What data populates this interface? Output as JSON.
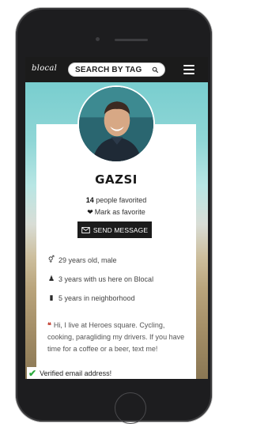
{
  "header": {
    "logo": "blocal",
    "search_placeholder": "SEARCH BY TAG"
  },
  "profile": {
    "name": "GAZSI",
    "favorited_count": "14",
    "favorited_text": " people favorited",
    "mark_favorite": "Mark as favorite",
    "send_message": "SEND MESSAGE"
  },
  "info": [
    {
      "icon": "gender-icon",
      "text": "29 years old, male"
    },
    {
      "icon": "person-icon",
      "text": "3 years with us here on Blocal"
    },
    {
      "icon": "book-icon",
      "text": "5 years in neighborhood"
    }
  ],
  "bio": "Hi, I live at Heroes square. Cycling, cooking, paragliding my drivers. If you have time for a coffee or a beer, text me!",
  "verified": "Verified email address!",
  "colors": {
    "accent_dark": "#1b1b1b",
    "quote_red": "#c0392b",
    "check_green": "#2eaa3f"
  }
}
